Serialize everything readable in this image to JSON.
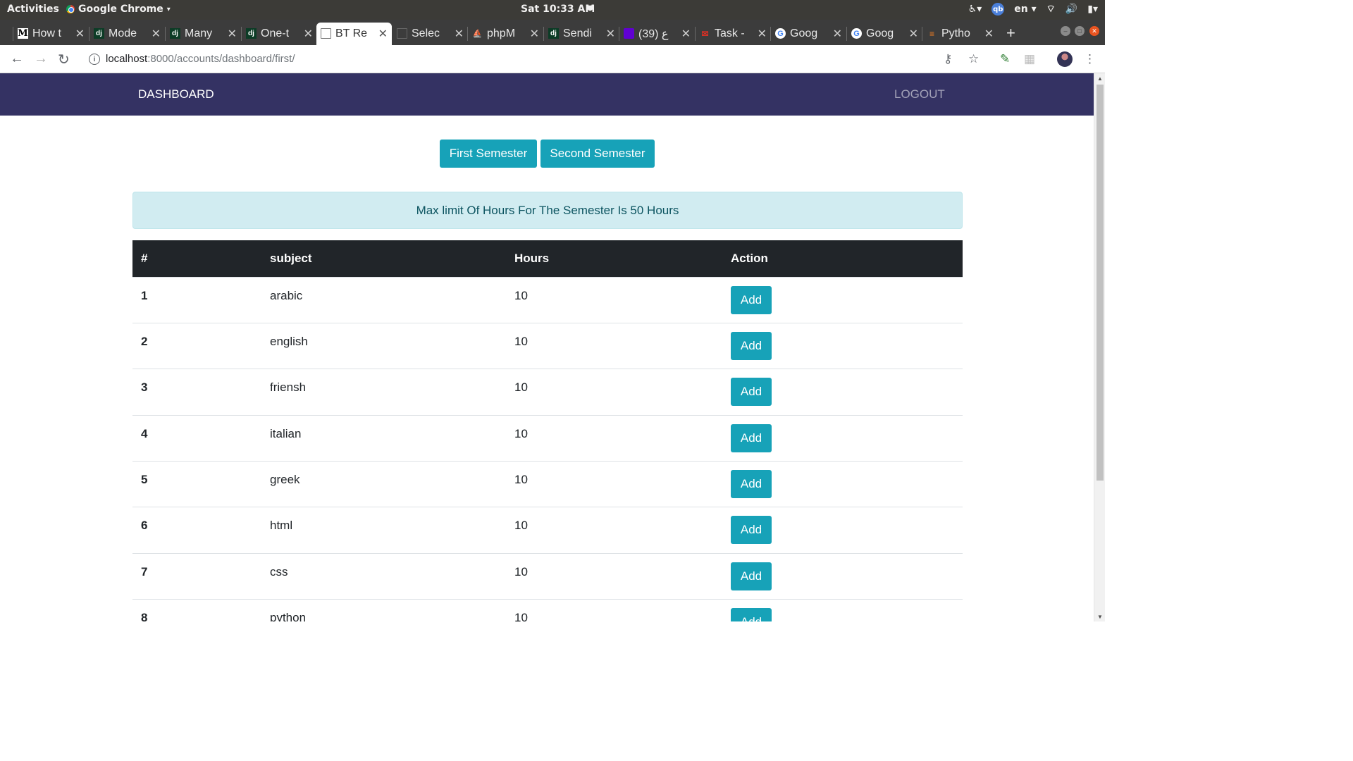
{
  "os": {
    "activities": "Activities",
    "app_name": "Google Chrome",
    "clock": "Sat 10:33 AM",
    "lang": "en",
    "qb_label": "qb"
  },
  "browser": {
    "tabs": [
      {
        "title": "How t",
        "favicon": "M"
      },
      {
        "title": "Mode",
        "favicon": "dj"
      },
      {
        "title": "Many",
        "favicon": "dj"
      },
      {
        "title": "One-t",
        "favicon": "dj"
      },
      {
        "title": "BT Re",
        "favicon": "doc",
        "active": true
      },
      {
        "title": "Selec",
        "favicon": "doc"
      },
      {
        "title": "phpM",
        "favicon": "pma"
      },
      {
        "title": "Sendi",
        "favicon": "dj"
      },
      {
        "title": "(39) ع",
        "favicon": "yahoo"
      },
      {
        "title": "Task -",
        "favicon": "gmail"
      },
      {
        "title": "Goog",
        "favicon": "G"
      },
      {
        "title": "Goog",
        "favicon": "G"
      },
      {
        "title": "Pytho",
        "favicon": "so"
      }
    ],
    "url_host": "localhost",
    "url_path": ":8000/accounts/dashboard/first/"
  },
  "page": {
    "brand": "DASHBOARD",
    "logout": "LOGOUT",
    "first_semester": "First Semester",
    "second_semester": "Second Semester",
    "alert": "Max limit Of Hours For The Semester Is 50 Hours",
    "table": {
      "headers": [
        "#",
        "subject",
        "Hours",
        "Action"
      ],
      "rows": [
        {
          "num": "1",
          "subject": "arabic",
          "hours": "10",
          "action": "Add"
        },
        {
          "num": "2",
          "subject": "english",
          "hours": "10",
          "action": "Add"
        },
        {
          "num": "3",
          "subject": "friensh",
          "hours": "10",
          "action": "Add"
        },
        {
          "num": "4",
          "subject": "italian",
          "hours": "10",
          "action": "Add"
        },
        {
          "num": "5",
          "subject": "greek",
          "hours": "10",
          "action": "Add"
        },
        {
          "num": "6",
          "subject": "html",
          "hours": "10",
          "action": "Add"
        },
        {
          "num": "7",
          "subject": "css",
          "hours": "10",
          "action": "Add"
        },
        {
          "num": "8",
          "subject": "python",
          "hours": "10",
          "action": "Add"
        }
      ]
    }
  },
  "colors": {
    "navbar": "#343263",
    "button_info": "#17a2b8",
    "alert_bg": "#d1ecf1",
    "alert_text": "#0c5460",
    "table_header": "#212529"
  }
}
